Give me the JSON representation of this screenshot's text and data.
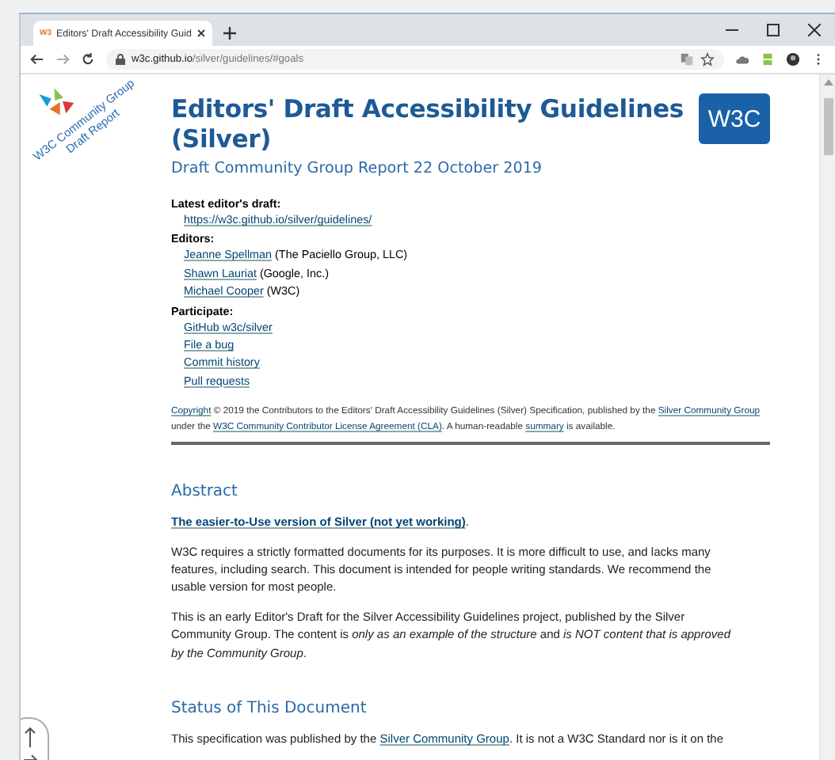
{
  "window": {
    "tab_title": "Editors' Draft Accessibility Guid",
    "tab_favicon": "W3",
    "address_host": "w3c.github.io",
    "address_path": "/silver/guidelines/#goals"
  },
  "logo_text": [
    "W3C Community Group",
    "Draft Report"
  ],
  "title": "Editors' Draft Accessibility Guidelines (Silver)",
  "w3c_logo": "W3C",
  "subtitle": "Draft Community Group Report 22 October 2019",
  "metadata": [
    {
      "label": "Latest editor's draft:",
      "items": [
        {
          "link": "https://w3c.github.io/silver/guidelines/"
        }
      ]
    },
    {
      "label": "Editors:",
      "items": [
        {
          "link": "Jeanne Spellman",
          "rest": " (The Paciello Group, LLC)"
        },
        {
          "link": "Shawn Lauriat",
          "rest": " (Google, Inc.)"
        },
        {
          "link": "Michael Cooper",
          "rest": " (W3C)"
        }
      ]
    },
    {
      "label": "Participate:",
      "items": [
        {
          "link": "GitHub w3c/silver"
        },
        {
          "link": "File a bug"
        },
        {
          "link": "Commit history"
        },
        {
          "link": "Pull requests"
        }
      ]
    }
  ],
  "copyright": [
    {
      "text": "Copyright",
      "link": true
    },
    {
      "text": " © 2019 the Contributors to the Editors' Draft Accessibility Guidelines (Silver) Specification, published by the ",
      "link": false
    },
    {
      "text": "Silver Community Group",
      "link": true
    },
    {
      "text": " under the ",
      "link": false
    },
    {
      "text": "W3C Community Contributor License Agreement (CLA)",
      "link": true
    },
    {
      "text": ". A human-readable ",
      "link": false
    },
    {
      "text": "summary",
      "link": true
    },
    {
      "text": " is available.",
      "link": false
    }
  ],
  "sections": [
    {
      "heading": "Abstract",
      "paragraphs": [
        [
          {
            "text": "The easier-to-Use version of Silver (not yet working)",
            "link": true,
            "bold": true
          },
          {
            "text": ".",
            "link": false
          }
        ],
        [
          {
            "text": "W3C requires a strictly formatted documents for its purposes. It is more difficult to use, and lacks many features, including search. This document is intended for people writing standards. We recommend the usable version for most people.",
            "link": false
          }
        ],
        [
          {
            "text": "This is an early Editor's Draft for the Silver Accessibility Guidelines project, published by the Silver Community Group. The content is *only as an example of the structure* and *is NOT content that is approved by the Community Group*.",
            "link": false
          }
        ]
      ]
    },
    {
      "heading": "Status of This Document",
      "paragraphs": [
        [
          {
            "text": "This specification was published by the ",
            "link": false
          },
          {
            "text": "Silver Community Group",
            "link": true
          },
          {
            "text": ". It is not a W3C Standard nor is it on the",
            "link": false
          }
        ]
      ]
    }
  ]
}
